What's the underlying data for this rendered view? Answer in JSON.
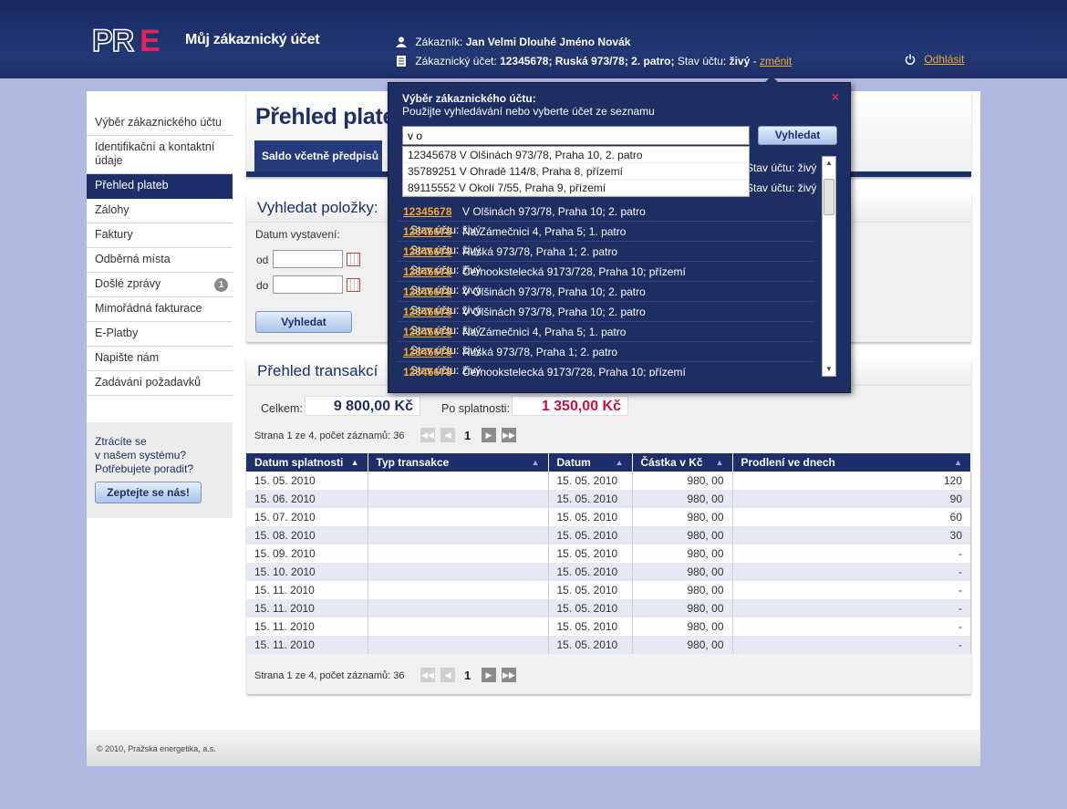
{
  "header": {
    "logo": "PRE",
    "title": "Můj zákaznický účet",
    "customer_label": "Zákazník:",
    "customer_name": "Jan Velmi Dlouhé Jméno Novák",
    "account_label": "Zákaznický účet:",
    "account_value": "12345678; Ruská 973/78; 2. patro;",
    "status_label": "Stav účtu:",
    "status_value": "živý",
    "dash": "-",
    "change_link": "změnit",
    "logout": "Odhlásit"
  },
  "sidebar": {
    "items": [
      {
        "label": "Výběr zákaznického účtu"
      },
      {
        "label": "Identifikační a kontaktní údaje"
      },
      {
        "label": "Přehled plateb"
      },
      {
        "label": "Zálohy"
      },
      {
        "label": "Faktury"
      },
      {
        "label": "Odběrná místa"
      },
      {
        "label": "Došlé zprávy",
        "badge": "1"
      },
      {
        "label": "Mimořádná fakturace"
      },
      {
        "label": "E-Platby"
      },
      {
        "label": "Napište nám"
      },
      {
        "label": "Zadávání požadavků"
      }
    ],
    "help_line1": "Ztrácíte se",
    "help_line2": "v našem systému?",
    "help_line3": "Potřebujete poradit?",
    "help_button": "Zeptejte se nás!"
  },
  "main": {
    "title": "Přehled plateb",
    "saldo": "Saldo včetně předpisů z",
    "search": {
      "title": "Vyhledat položky:",
      "date_label": "Datum vystavení:",
      "from_label": "od",
      "to_label": "do",
      "button": "Vyhledat"
    },
    "transactions": {
      "title": "Přehled transakcí",
      "total_label": "Celkem:",
      "total_value": "9 800,00 Kč",
      "overdue_label": "Po splatnosti:",
      "overdue_value": "1 350,00 Kč",
      "pager_text": "Strana 1 ze 4, počet záznamů: 36",
      "page": "1",
      "columns": [
        "Datum splatnosti",
        "Typ transakce",
        "Datum",
        "Částka v Kč",
        "Prodlení ve dnech"
      ],
      "rows": [
        [
          "15. 05. 2010",
          "",
          "15. 05. 2010",
          "980, 00",
          "120"
        ],
        [
          "15. 06. 2010",
          "",
          "15. 05. 2010",
          "980, 00",
          "90"
        ],
        [
          "15. 07. 2010",
          "",
          "15. 05. 2010",
          "980, 00",
          "60"
        ],
        [
          "15. 08. 2010",
          "",
          "15. 05. 2010",
          "980, 00",
          "30"
        ],
        [
          "15. 09. 2010",
          "",
          "15. 05. 2010",
          "980, 00",
          "-"
        ],
        [
          "15. 10. 2010",
          "",
          "15. 05. 2010",
          "980, 00",
          "-"
        ],
        [
          "15. 11. 2010",
          "",
          "15. 05. 2010",
          "980, 00",
          "-"
        ],
        [
          "15. 11. 2010",
          "",
          "15. 05. 2010",
          "980, 00",
          "-"
        ],
        [
          "15. 11. 2010",
          "",
          "15. 05. 2010",
          "980, 00",
          "-"
        ],
        [
          "15. 11. 2010",
          "",
          "15. 05. 2010",
          "980, 00",
          "-"
        ]
      ]
    }
  },
  "dialog": {
    "title": "Výběr zákaznického účtu:",
    "subtitle": "Použijte vyhledávání nebo vyberte účet ze seznamu",
    "close": "×",
    "search_value": "v o",
    "search_button": "Vyhledat",
    "suggestions": [
      "12345678 V Olšinách 973/78, Praha 10, 2. patro",
      "35789251 V Ohradě 114/8, Praha 8, přízemí",
      "89115552 V Okolí 7/55, Praha 9, přízemí"
    ],
    "accounts": [
      {
        "num": "12345678",
        "addr": "V Olšinách 973/78, Praha 10; 2. patro",
        "status": "Stav účtu: živý"
      },
      {
        "num": "12345678",
        "addr": "Na Zámečnici 4, Praha 5; 1. patro",
        "status": "Stav účtu: živý"
      },
      {
        "num": "12345678",
        "addr": "Ruská 973/78, Praha 1; 2. patro",
        "status": "Stav účtu: živý"
      },
      {
        "num": "12345678",
        "addr": "Černookstelecká 9173/728, Praha 10; přízemí",
        "status": "Stav účtu: živý"
      },
      {
        "num": "12345678",
        "addr": "V Olšinách 973/78, Praha 10; 2. patro",
        "status": "Stav účtu: živý"
      },
      {
        "num": "12345678",
        "addr": "V Olšinách 973/78, Praha 10; 2. patro",
        "status": "Stav účtu: živý"
      },
      {
        "num": "12345678",
        "addr": "Na Zámečnici 4, Praha 5; 1. patro",
        "status": "Stav účtu: živý"
      },
      {
        "num": "12345678",
        "addr": "Ruská 973/78, Praha 1; 2. patro",
        "status": "Stav účtu: živý"
      },
      {
        "num": "12345678",
        "addr": "Černookstelecká 9173/728, Praha 10; přízemí",
        "status": "Stav účtu: živý"
      }
    ],
    "hidden_status_1": "Stav účtu: živý",
    "hidden_status_2": "Stav účtu: živý"
  },
  "footer": {
    "copyright": "© 2010, Pražská energetika, a.s."
  },
  "colors": {
    "navy": "#1c2f6a",
    "accent_orange": "#f2a92c",
    "alert_red": "#d0103a",
    "background": "#b2b9e0"
  }
}
